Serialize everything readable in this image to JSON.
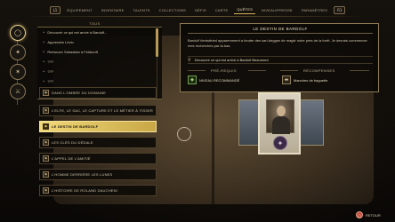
{
  "nav": {
    "left_key": "L1",
    "right_key": "R1",
    "tabs": [
      "ÉQUIPEMENT",
      "INVENTAIRE",
      "TALENTS",
      "COLLECTIONS",
      "DÉFIS",
      "CARTE",
      "QUÊTES",
      "NIVEAU/PRESSE",
      "PARAMÈTRES"
    ],
    "active_tab": "QUÊTES"
  },
  "rail": {
    "icons": [
      "◯",
      "✦",
      "✶",
      "⚔",
      "✧"
    ]
  },
  "list": {
    "category_label": "TOUS",
    "tracked_items": [
      "Découvrir ce qui est arrivé à Bardolf...",
      "Apprendre Lévio",
      "Retrouver Sebastian à Feldcroft",
      "???",
      "???",
      "???",
      "???"
    ],
    "quests": [
      {
        "name": "DANS L'OMBRE DU DOMAINE",
        "icon": "⚑",
        "active": false
      },
      {
        "name": "L'ELFE, LE SAC, LE CAPTURE ET LE MÉTIER À TISSER",
        "icon": "⚑",
        "active": false
      },
      {
        "name": "LE DESTIN DE BARDOLF",
        "icon": "⚑",
        "active": true
      },
      {
        "name": "LES CLÉS DU DÉDALE",
        "icon": "⚑",
        "active": false
      },
      {
        "name": "L'APPEL DE L'AMITIÉ",
        "icon": "⚑",
        "active": false
      },
      {
        "name": "L'HOMME DERRIÈRE LES LUNES",
        "icon": "⚑",
        "active": false
      },
      {
        "name": "L'HISTOIRE DE ROLAND DAUCHENI",
        "icon": "⚑",
        "active": false
      }
    ]
  },
  "detail": {
    "title": "LE DESTIN DE BARDOLF",
    "description": "Bardolf Verbsttried apparemment a fonder des sarl-degges de magie noire près de la forêt. Je devrais commencer mes recherches par là-bas.",
    "objective": "Découvrir ce qui est arrivé à Bardolf Beaumont",
    "requirements_header": "PRÉ-REQUIS",
    "requirement": "NIVEAU RECOMMANDÉ",
    "requirement_icon": "◆",
    "rewards_header": "RÉCOMPENSES",
    "reward": "Manches de baguette",
    "reward_icon": "▬"
  },
  "cards": {
    "crest_symbol": "✦"
  },
  "footer": {
    "back_label": "RETOUR",
    "back_key": "○"
  }
}
